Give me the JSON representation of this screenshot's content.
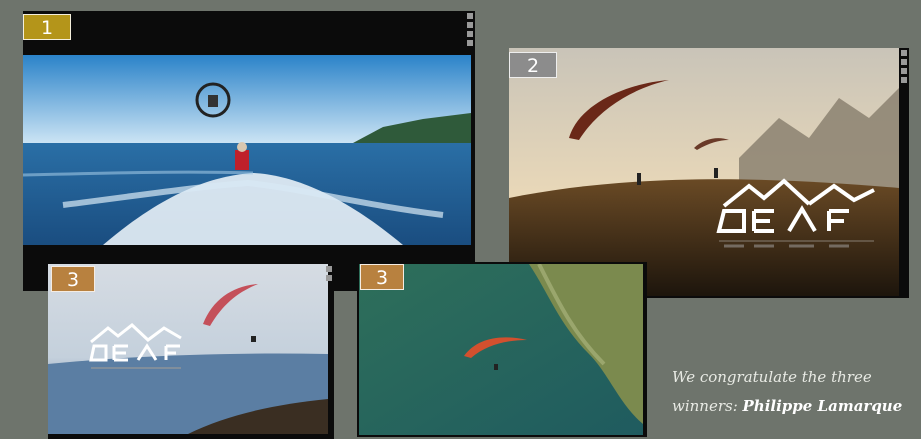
{
  "panels": [
    {
      "rank_label": "1",
      "badge_color": "#b4951a"
    },
    {
      "rank_label": "2",
      "badge_color": "#8c8c8c"
    },
    {
      "rank_label": "3",
      "badge_color": "#b8813f"
    },
    {
      "rank_label": "3",
      "badge_color": "#b8813f"
    }
  ],
  "caption": {
    "line1": "We congratulate the three",
    "line2_prefix": "winners: ",
    "line2_name": "Philippe Lamarque"
  }
}
